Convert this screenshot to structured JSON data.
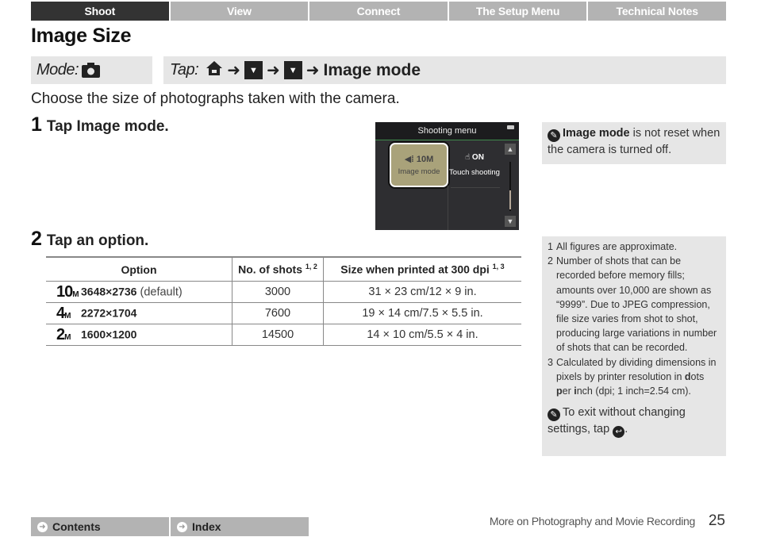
{
  "nav": {
    "tabs": [
      {
        "label": "Shoot",
        "active": true
      },
      {
        "label": "View",
        "active": false
      },
      {
        "label": "Connect",
        "active": false
      },
      {
        "label": "The Setup Menu",
        "active": false
      },
      {
        "label": "Technical Notes",
        "active": false
      }
    ]
  },
  "page": {
    "title": "Image Size",
    "mode_label": "Mode:",
    "mode_icon": "camera-icon",
    "tap_label": "Tap:",
    "tap_path": [
      "home-icon",
      "arrow-right",
      "scroll-down-icon",
      "arrow-right",
      "scroll-down-icon",
      "arrow-right"
    ],
    "tap_destination": "Image mode",
    "arrow_glyph": "➜",
    "intro": "Choose the size of photographs taken with the camera."
  },
  "steps": [
    {
      "number": "1",
      "text": "Tap Image mode."
    },
    {
      "number": "2",
      "text": "Tap an option."
    }
  ],
  "screen": {
    "header": "Shooting menu",
    "buttons": [
      {
        "icon_text": "◀⁞ 10M",
        "label": "Image mode",
        "selected": true
      },
      {
        "icon_text": "☝ ON",
        "label": "Touch shooting",
        "selected": false
      }
    ],
    "scroll_up": "▲",
    "scroll_down": "▼"
  },
  "note1": {
    "bold": "Image mode",
    "text": " is not reset when the camera is turned off."
  },
  "table": {
    "headers": {
      "option": "Option",
      "shots": "No. of shots",
      "shots_sup": "1, 2",
      "size": "Size when printed at 300 dpi",
      "size_sup": "1, 3"
    },
    "rows": [
      {
        "icon_num": "10",
        "icon_unit": "M",
        "dimensions": "3648×2736",
        "suffix": " (default)",
        "shots": "3000",
        "print_size": "31 × 23 cm/12 × 9 in."
      },
      {
        "icon_num": "4",
        "icon_unit": "M",
        "dimensions": "2272×1704",
        "suffix": "",
        "shots": "7600",
        "print_size": "19 × 14 cm/7.5 × 5.5 in."
      },
      {
        "icon_num": "2",
        "icon_unit": "M",
        "dimensions": "1600×1200",
        "suffix": "",
        "shots": "14500",
        "print_size": "14 × 10 cm/5.5 × 4 in."
      }
    ]
  },
  "footnotes": {
    "items": [
      {
        "n": "1",
        "text": "All figures are approximate."
      },
      {
        "n": "2",
        "text": "Number of shots that can be recorded before memory fills; amounts over 10,000 are shown as “9999”. Due to JPEG compression, file size varies from shot to shot, producing large variations in number of shots that can be recorded."
      },
      {
        "n": "3",
        "text_a": "Calculated by dividing dimensions in pixels by printer resolution in ",
        "d": "d",
        "text_b": "ots ",
        "p": "p",
        "text_c": "er ",
        "i": "i",
        "text_d": "nch (dpi; 1 inch=2.54 cm)."
      }
    ],
    "exit_text": "To exit without changing settings, tap",
    "exit_end": "."
  },
  "footer": {
    "contents": "Contents",
    "index": "Index",
    "section": "More on Photography and Movie Recording",
    "page_number": "25"
  }
}
